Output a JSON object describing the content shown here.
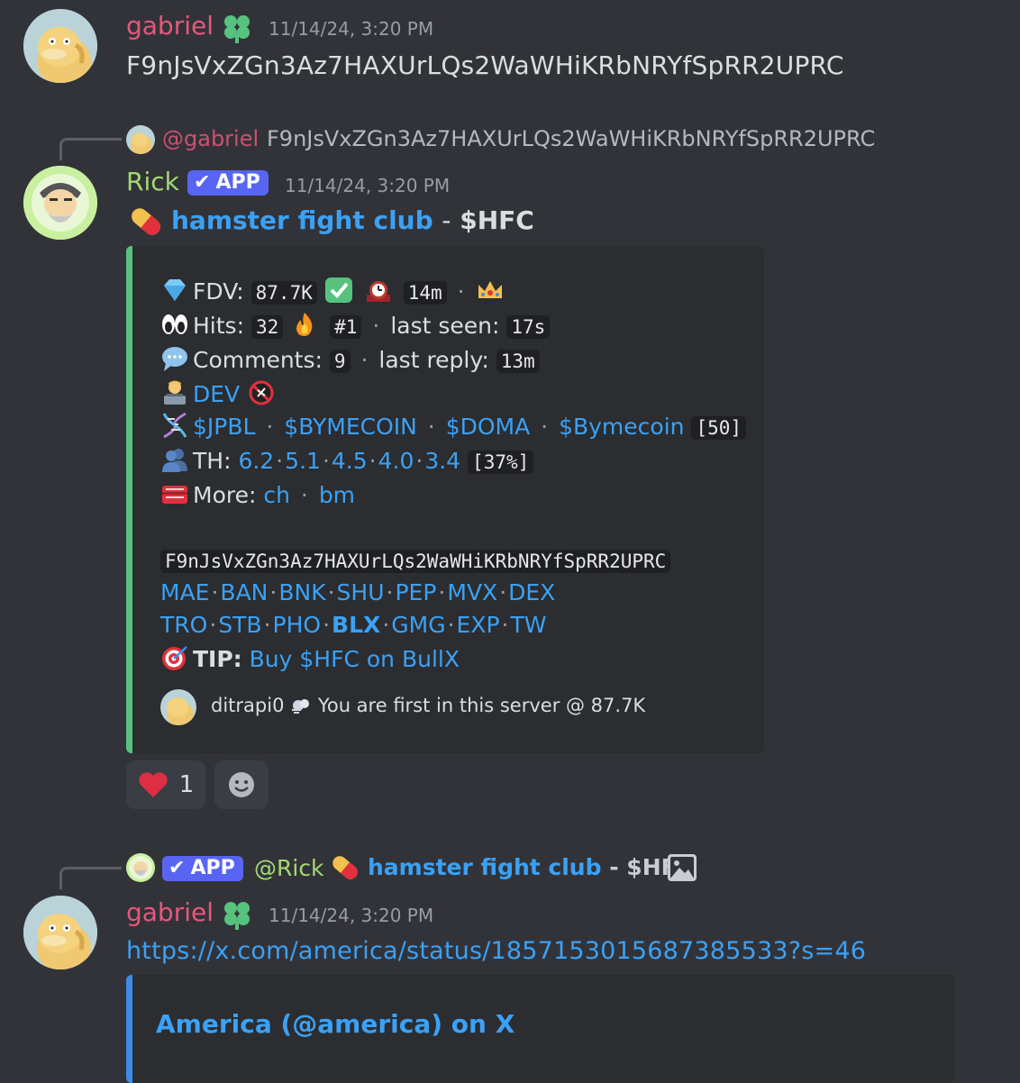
{
  "messages": [
    {
      "author": "gabriel",
      "author_color": "#e8577a",
      "timestamp": "11/14/24, 3:20 PM",
      "content": "F9nJsVxZGn3Az7HAXUrLQs2WaWHiKRbNRYfSpRR2UPRC"
    }
  ],
  "reply1": {
    "mention": "@gabriel",
    "text": "F9nJsVxZGn3Az7HAXUrLQs2WaWHiKRbNRYfSpRR2UPRC"
  },
  "rick": {
    "author": "Rick",
    "author_color": "#a4d974",
    "badge": "APP",
    "timestamp": "11/14/24, 3:20 PM",
    "title_link": "hamster fight club",
    "title_sep": "-",
    "title_ticker": "$HFC"
  },
  "embed": {
    "fdv_label": "FDV:",
    "fdv_value": "87.7K",
    "age": "14m",
    "hits_label": "Hits:",
    "hits_value": "32",
    "rank": "#1",
    "last_seen_label": "last seen:",
    "last_seen": "17s",
    "comments_label": "Comments:",
    "comments_value": "9",
    "last_reply_label": "last reply:",
    "last_reply": "13m",
    "dev_label": "DEV",
    "tokens": [
      "$JPBL",
      "$BYMECOIN",
      "$DOMA",
      "$Bymecoin"
    ],
    "tokens_count": "[50]",
    "th_label": "TH:",
    "th_values": [
      "6.2",
      "5.1",
      "4.5",
      "4.0",
      "3.4"
    ],
    "th_pct": "[37%]",
    "more_label": "More:",
    "more_links": [
      "ch",
      "bm"
    ],
    "contract": "F9nJsVxZGn3Az7HAXUrLQs2WaWHiKRbNRYfSpRR2UPRC",
    "links_row1": [
      "MAE",
      "BAN",
      "BNK",
      "SHU",
      "PEP",
      "MVX",
      "DEX"
    ],
    "links_row2": [
      "TRO",
      "STB",
      "PHO",
      "BLX",
      "GMG",
      "EXP",
      "TW"
    ],
    "tip_label": "TIP:",
    "tip_link": "Buy $HFC on BullX",
    "footer_user": "ditrapi0",
    "footer_text": "You are first in this server @ 87.7K"
  },
  "reactions": {
    "heart_count": "1"
  },
  "reply2": {
    "badge": "APP",
    "mention": "@Rick",
    "title_link": "hamster fight club",
    "title_rest": "- $HFC"
  },
  "message3": {
    "author": "gabriel",
    "timestamp": "11/14/24, 3:20 PM",
    "link": "https://x.com/america/status/1857153015687385533?s=46",
    "embed_title": "America (@america) on X"
  },
  "colors": {
    "background": "#323339",
    "embed_bg": "#2b2d31",
    "embed_accent": "#57c27e",
    "link": "#3ba1f5",
    "app_badge": "#5865f2",
    "x_embed_accent": "#3b8ded"
  }
}
